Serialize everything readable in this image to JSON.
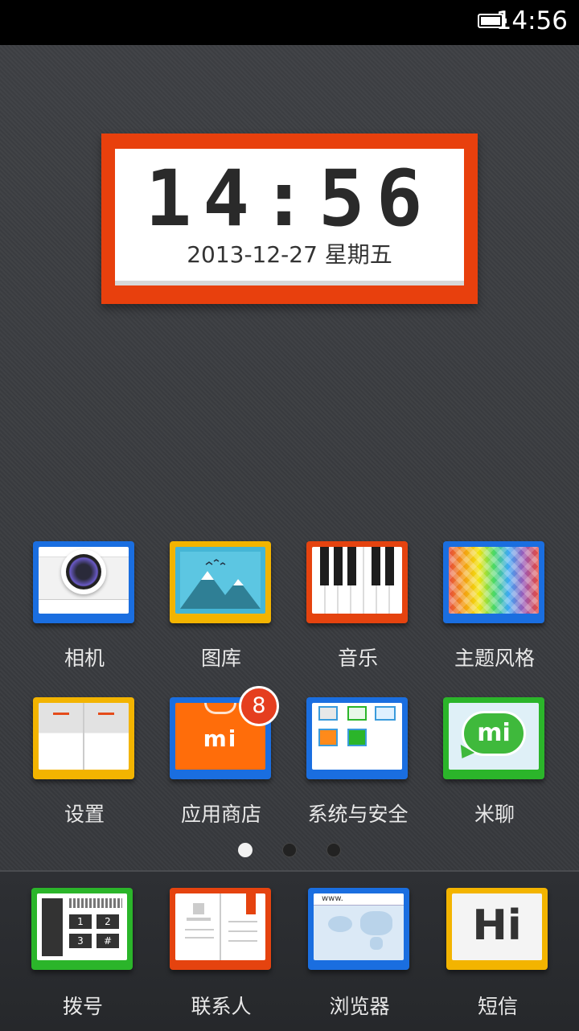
{
  "status_bar": {
    "time": "14:56"
  },
  "clock_widget": {
    "time": "14:56",
    "date": "2013-12-27  星期五"
  },
  "apps": [
    {
      "label": "相机",
      "icon": "camera-icon",
      "color": "#1a6ee0"
    },
    {
      "label": "图库",
      "icon": "gallery-icon",
      "color": "#f3b400"
    },
    {
      "label": "音乐",
      "icon": "piano-icon",
      "color": "#e5430f"
    },
    {
      "label": "主题风格",
      "icon": "themes-icon",
      "color": "#1a6ee0"
    },
    {
      "label": "设置",
      "icon": "settings-icon",
      "color": "#f3b400"
    },
    {
      "label": "应用商店",
      "icon": "mi-store-icon",
      "color": "#1a6ee0",
      "badge": "8"
    },
    {
      "label": "系统与安全",
      "icon": "system-security-icon",
      "color": "#1a6ee0"
    },
    {
      "label": "米聊",
      "icon": "miliao-chat-icon",
      "color": "#2bb52a"
    }
  ],
  "store_icon_text": "mi",
  "miliao_icon_text": "mi",
  "page_indicator": {
    "pages": 3,
    "current": 1
  },
  "dock": [
    {
      "label": "拨号",
      "icon": "dialer-icon",
      "color": "#2bb52a"
    },
    {
      "label": "联系人",
      "icon": "contacts-icon",
      "color": "#e5430f"
    },
    {
      "label": "浏览器",
      "icon": "browser-icon",
      "color": "#1a6ee0"
    },
    {
      "label": "短信",
      "icon": "messages-icon",
      "color": "#f3b400"
    }
  ],
  "dialer_keys": [
    "1",
    "2",
    "3",
    "#"
  ],
  "browser_url": "www.",
  "messages_icon_text": "Hi"
}
